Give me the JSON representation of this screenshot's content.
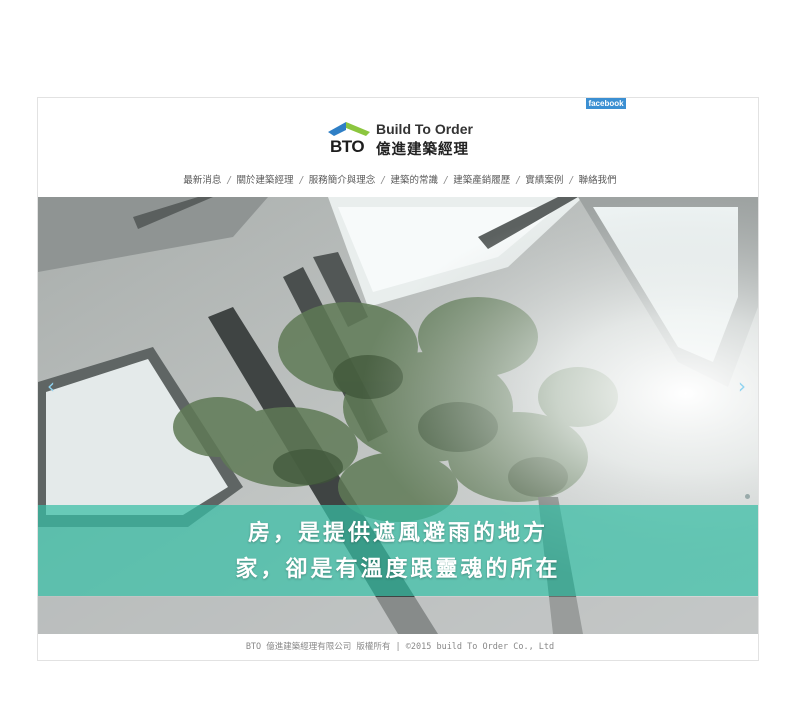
{
  "header": {
    "facebook_label": "facebook",
    "logo_abbr": "BTO",
    "logo_en": "Build To Order",
    "logo_zh": "億進建築經理"
  },
  "nav": {
    "items": [
      "最新消息",
      "關於建築經理",
      "服務簡介與理念",
      "建築的常識",
      "建築產銷履歷",
      "實績案例",
      "聯絡我們"
    ],
    "separator": "/"
  },
  "hero": {
    "caption_line1": "房，是提供遮風避雨的地方",
    "caption_line2": "家，卻是有溫度跟靈魂的所在",
    "prev_glyph": "‹",
    "next_glyph": "›"
  },
  "footer": {
    "text": "BTO 億進建築經理有限公司 版權所有 | ©2015 build To Order Co., Ltd"
  },
  "colors": {
    "band": "#38bea5",
    "logo_blue": "#2f7fc6",
    "logo_green": "#8cc63f",
    "facebook": "#3b8fd2"
  }
}
